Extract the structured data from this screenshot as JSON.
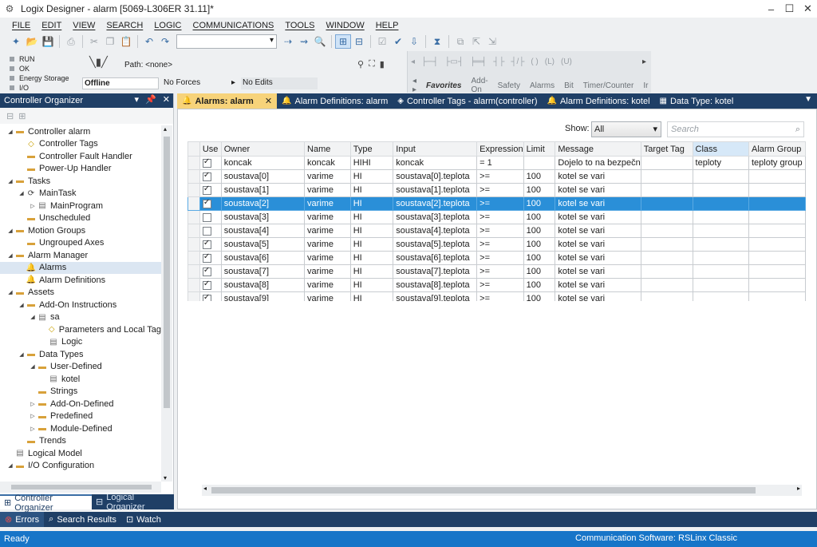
{
  "window": {
    "title": "Logix Designer - alarm [5069-L306ER 31.11]*",
    "app_icon": "logix-icon",
    "minimize": "–",
    "maximize": "☐",
    "close": "✕"
  },
  "menu": [
    "FILE",
    "EDIT",
    "VIEW",
    "SEARCH",
    "LOGIC",
    "COMMUNICATIONS",
    "TOOLS",
    "WINDOW",
    "HELP"
  ],
  "controller_status": {
    "lights": [
      "RUN",
      "OK",
      "Energy Storage",
      "I/O"
    ],
    "path": "Path: <none>",
    "state": "Offline",
    "forces": "No Forces",
    "edits": "No Edits"
  },
  "ladder_palette": {
    "tabs": [
      "Favorites",
      "Add-On",
      "Safety",
      "Alarms",
      "Bit",
      "Timer/Counter",
      "Ir"
    ],
    "selected": "Favorites"
  },
  "controller_organizer": {
    "title": "Controller Organizer",
    "tree": [
      {
        "label": "Controller alarm",
        "level": 0,
        "exp": "◢",
        "icon": "folder"
      },
      {
        "label": "Controller Tags",
        "level": 1,
        "exp": "",
        "icon": "tag"
      },
      {
        "label": "Controller Fault Handler",
        "level": 1,
        "exp": "",
        "icon": "folder"
      },
      {
        "label": "Power-Up Handler",
        "level": 1,
        "exp": "",
        "icon": "folder"
      },
      {
        "label": "Tasks",
        "level": 0,
        "exp": "◢",
        "icon": "folder"
      },
      {
        "label": "MainTask",
        "level": 1,
        "exp": "◢",
        "icon": "task"
      },
      {
        "label": "MainProgram",
        "level": 2,
        "exp": "▷",
        "icon": "doc"
      },
      {
        "label": "Unscheduled",
        "level": 1,
        "exp": "",
        "icon": "folder"
      },
      {
        "label": "Motion Groups",
        "level": 0,
        "exp": "◢",
        "icon": "folder"
      },
      {
        "label": "Ungrouped Axes",
        "level": 1,
        "exp": "",
        "icon": "folder"
      },
      {
        "label": "Alarm Manager",
        "level": 0,
        "exp": "◢",
        "icon": "folder"
      },
      {
        "label": "Alarms",
        "level": 1,
        "exp": "",
        "icon": "bell",
        "selected": true
      },
      {
        "label": "Alarm Definitions",
        "level": 1,
        "exp": "",
        "icon": "bell"
      },
      {
        "label": "Assets",
        "level": 0,
        "exp": "◢",
        "icon": "folder"
      },
      {
        "label": "Add-On Instructions",
        "level": 1,
        "exp": "◢",
        "icon": "folder"
      },
      {
        "label": "sa",
        "level": 2,
        "exp": "◢",
        "icon": "doc"
      },
      {
        "label": "Parameters and Local Tag",
        "level": 3,
        "exp": "",
        "icon": "tag"
      },
      {
        "label": "Logic",
        "level": 3,
        "exp": "",
        "icon": "doc"
      },
      {
        "label": "Data Types",
        "level": 1,
        "exp": "◢",
        "icon": "folder"
      },
      {
        "label": "User-Defined",
        "level": 2,
        "exp": "◢",
        "icon": "folder"
      },
      {
        "label": "kotel",
        "level": 3,
        "exp": "",
        "icon": "doc"
      },
      {
        "label": "Strings",
        "level": 2,
        "exp": "",
        "icon": "folder"
      },
      {
        "label": "Add-On-Defined",
        "level": 2,
        "exp": "▷",
        "icon": "folder"
      },
      {
        "label": "Predefined",
        "level": 2,
        "exp": "▷",
        "icon": "folder"
      },
      {
        "label": "Module-Defined",
        "level": 2,
        "exp": "▷",
        "icon": "folder"
      },
      {
        "label": "Trends",
        "level": 1,
        "exp": "",
        "icon": "folder"
      },
      {
        "label": "Logical Model",
        "level": 0,
        "exp": "",
        "icon": "doc"
      },
      {
        "label": "I/O Configuration",
        "level": 0,
        "exp": "◢",
        "icon": "folder"
      }
    ],
    "tabs": [
      "Controller Organizer",
      "Logical Organizer"
    ]
  },
  "doc_tabs": [
    {
      "label": "Alarms: alarm",
      "icon": "🔔",
      "active": true
    },
    {
      "label": "Alarm Definitions: alarm",
      "icon": "🔔",
      "active": false
    },
    {
      "label": "Controller Tags - alarm(controller)",
      "icon": "◈",
      "active": false
    },
    {
      "label": "Alarm Definitions: kotel",
      "icon": "🔔",
      "active": false
    },
    {
      "label": "Data Type: kotel",
      "icon": "▦",
      "active": false
    }
  ],
  "alarms_view": {
    "show_label": "Show:",
    "show_value": "All",
    "search_placeholder": "Search",
    "columns": [
      "Use",
      "Owner",
      "Name",
      "Type",
      "Input",
      "Expression",
      "Limit",
      "Message",
      "Target Tag",
      "Class",
      "Alarm Group"
    ],
    "rows": [
      {
        "use": true,
        "owner": "koncak",
        "name": "koncak",
        "type": "HIHI",
        "input": "koncak",
        "expression": "= 1",
        "limit": "",
        "message": "Dojelo to na bezpečn",
        "target": "",
        "class": "teploty",
        "group": "teploty group"
      },
      {
        "use": true,
        "owner": "soustava[0]",
        "name": "varime",
        "type": "HI",
        "input": "soustava[0].teplota",
        "expression": ">=",
        "limit": "100",
        "message": "kotel se vari",
        "target": "",
        "class": "",
        "group": ""
      },
      {
        "use": true,
        "owner": "soustava[1]",
        "name": "varime",
        "type": "HI",
        "input": "soustava[1].teplota",
        "expression": ">=",
        "limit": "100",
        "message": "kotel se vari",
        "target": "",
        "class": "",
        "group": ""
      },
      {
        "use": true,
        "owner": "soustava[2]",
        "name": "varime",
        "type": "HI",
        "input": "soustava[2].teplota",
        "expression": ">=",
        "limit": "100",
        "message": "kotel se vari",
        "target": "",
        "class": "",
        "group": "",
        "selected": true
      },
      {
        "use": false,
        "owner": "soustava[3]",
        "name": "varime",
        "type": "HI",
        "input": "soustava[3].teplota",
        "expression": ">=",
        "limit": "100",
        "message": "kotel se vari",
        "target": "",
        "class": "",
        "group": ""
      },
      {
        "use": false,
        "owner": "soustava[4]",
        "name": "varime",
        "type": "HI",
        "input": "soustava[4].teplota",
        "expression": ">=",
        "limit": "100",
        "message": "kotel se vari",
        "target": "",
        "class": "",
        "group": ""
      },
      {
        "use": true,
        "owner": "soustava[5]",
        "name": "varime",
        "type": "HI",
        "input": "soustava[5].teplota",
        "expression": ">=",
        "limit": "100",
        "message": "kotel se vari",
        "target": "",
        "class": "",
        "group": ""
      },
      {
        "use": true,
        "owner": "soustava[6]",
        "name": "varime",
        "type": "HI",
        "input": "soustava[6].teplota",
        "expression": ">=",
        "limit": "100",
        "message": "kotel se vari",
        "target": "",
        "class": "",
        "group": ""
      },
      {
        "use": true,
        "owner": "soustava[7]",
        "name": "varime",
        "type": "HI",
        "input": "soustava[7].teplota",
        "expression": ">=",
        "limit": "100",
        "message": "kotel se vari",
        "target": "",
        "class": "",
        "group": ""
      },
      {
        "use": true,
        "owner": "soustava[8]",
        "name": "varime",
        "type": "HI",
        "input": "soustava[8].teplota",
        "expression": ">=",
        "limit": "100",
        "message": "kotel se vari",
        "target": "",
        "class": "",
        "group": ""
      },
      {
        "use": true,
        "owner": "soustava[9]",
        "name": "varime",
        "type": "HI",
        "input": "soustava[9].teplota",
        "expression": ">=",
        "limit": "100",
        "message": "kotel se vari",
        "target": "",
        "class": "",
        "group": ""
      }
    ]
  },
  "results_tabs": [
    "Errors",
    "Search Results",
    "Watch"
  ],
  "statusbar": {
    "left": "Ready",
    "right": "Communication Software: RSLinx Classic"
  },
  "colors": {
    "selection": "#2a8fd8",
    "header_navy": "#1f3f66",
    "active_tab": "#f7d37a",
    "statusbar": "#1775c8"
  }
}
